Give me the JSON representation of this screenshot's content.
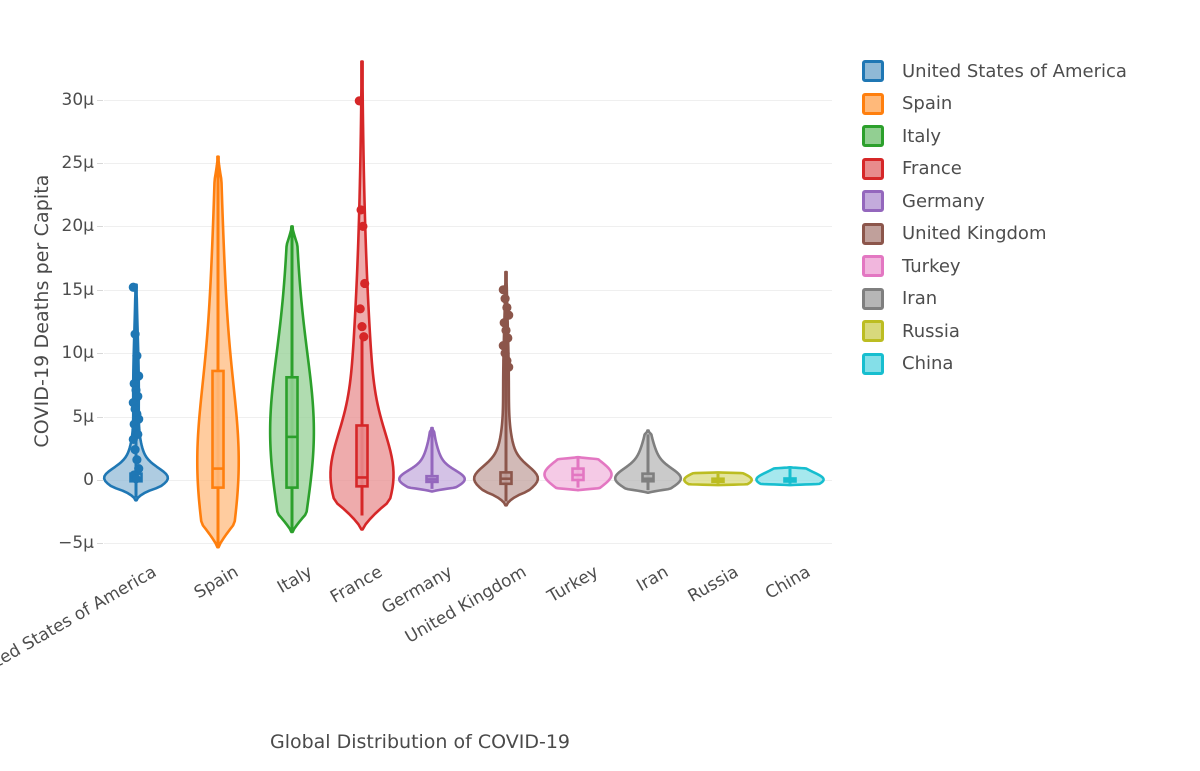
{
  "chart_data": {
    "type": "violin",
    "title": "",
    "xlabel": "Global Distribution of COVID-19",
    "ylabel": "COVID-19 Deaths per Capita",
    "ylim": [
      -7.5,
      34
    ],
    "ytick_labels": [
      "30μ",
      "25μ",
      "20μ",
      "15μ",
      "10μ",
      "5μ",
      "0",
      "−5μ"
    ],
    "ytick_values": [
      30,
      25,
      20,
      15,
      10,
      5,
      0,
      -5
    ],
    "grid": true,
    "legend_position": "right",
    "categories": [
      "United States of America",
      "Spain",
      "Italy",
      "France",
      "Germany",
      "United Kingdom",
      "Turkey",
      "Iran",
      "Russia",
      "China"
    ],
    "series": [
      {
        "name": "United States of America",
        "color": "#1f77b4",
        "fill": "#8fb9d6",
        "min": -1.4,
        "q1": -0.1,
        "median": 0.15,
        "q3": 0.5,
        "max": 15.2,
        "violin_top": 15.4,
        "violin_bottom": -1.6,
        "points": [
          15.2,
          11.5,
          9.8,
          8.2,
          7.6,
          7.1,
          6.6,
          6.1,
          5.6,
          5.2,
          4.8,
          4.4,
          4.0,
          3.6,
          3.2,
          2.4,
          1.6,
          0.9,
          0.4,
          0.1
        ]
      },
      {
        "name": "Spain",
        "color": "#ff7f0e",
        "fill": "#ffb97a",
        "min": -5.3,
        "q1": -0.6,
        "median": 0.9,
        "q3": 8.6,
        "max": 25.5,
        "violin_top": 25.5,
        "violin_bottom": -5.3,
        "points": []
      },
      {
        "name": "Italy",
        "color": "#2ca02c",
        "fill": "#92cf92",
        "min": -4.1,
        "q1": -0.6,
        "median": 3.4,
        "q3": 8.1,
        "max": 20.0,
        "violin_top": 20.0,
        "violin_bottom": -4.1,
        "points": []
      },
      {
        "name": "France",
        "color": "#d62728",
        "fill": "#e88b8c",
        "min": -2.8,
        "q1": -0.5,
        "median": 0.2,
        "q3": 4.3,
        "max": 11.2,
        "violin_top": 33.0,
        "violin_bottom": -3.9,
        "points": [
          29.9,
          21.3,
          20.0,
          15.5,
          13.5,
          12.1,
          11.3
        ]
      },
      {
        "name": "Germany",
        "color": "#9467bd",
        "fill": "#c3abdc",
        "min": -0.7,
        "q1": -0.15,
        "median": 0.05,
        "q3": 0.3,
        "max": 3.9,
        "violin_top": 4.1,
        "violin_bottom": -0.9,
        "points": []
      },
      {
        "name": "United Kingdom",
        "color": "#8c564b",
        "fill": "#c0a09b",
        "min": -1.7,
        "q1": -0.3,
        "median": 0.1,
        "q3": 0.6,
        "max": 16.3,
        "violin_top": 16.4,
        "violin_bottom": -2.0,
        "points": [
          15.0,
          14.3,
          13.6,
          13.0,
          12.4,
          11.8,
          11.2,
          10.6,
          10.0,
          9.4,
          8.9
        ]
      },
      {
        "name": "Turkey",
        "color": "#e377c2",
        "fill": "#f1b6dd",
        "min": -0.6,
        "q1": 0.0,
        "median": 0.4,
        "q3": 0.9,
        "max": 1.7,
        "violin_top": 1.8,
        "violin_bottom": -0.8,
        "points": []
      },
      {
        "name": "Iran",
        "color": "#7f7f7f",
        "fill": "#b6b6b6",
        "min": -0.8,
        "q1": -0.1,
        "median": 0.1,
        "q3": 0.5,
        "max": 3.6,
        "violin_top": 3.9,
        "violin_bottom": -1.0,
        "points": []
      },
      {
        "name": "Russia",
        "color": "#bcbd22",
        "fill": "#d8d97c",
        "min": -0.3,
        "q1": -0.05,
        "median": 0.0,
        "q3": 0.1,
        "max": 0.5,
        "violin_top": 0.6,
        "violin_bottom": -0.4,
        "points": []
      },
      {
        "name": "China",
        "color": "#17becf",
        "fill": "#84dfe8",
        "min": -0.3,
        "q1": -0.05,
        "median": 0.02,
        "q3": 0.12,
        "max": 0.9,
        "violin_top": 1.0,
        "violin_bottom": -0.4,
        "points": []
      }
    ]
  },
  "axes": {
    "ylabel": "COVID-19 Deaths per Capita",
    "xlabel": "Global Distribution of COVID-19",
    "yticks": [
      {
        "label": "30μ",
        "value": 30
      },
      {
        "label": "25μ",
        "value": 25
      },
      {
        "label": "20μ",
        "value": 20
      },
      {
        "label": "15μ",
        "value": 15
      },
      {
        "label": "10μ",
        "value": 10
      },
      {
        "label": "5μ",
        "value": 5
      },
      {
        "label": "0",
        "value": 0
      },
      {
        "label": "−5μ",
        "value": -5
      }
    ],
    "xticks": [
      "United States of America",
      "Spain",
      "Italy",
      "France",
      "Germany",
      "United Kingdom",
      "Turkey",
      "Iran",
      "Russia",
      "China"
    ]
  },
  "legend": {
    "items": [
      {
        "label": "United States of America",
        "color": "#1f77b4",
        "fill": "#8fb9d6"
      },
      {
        "label": "Spain",
        "color": "#ff7f0e",
        "fill": "#ffb97a"
      },
      {
        "label": "Italy",
        "color": "#2ca02c",
        "fill": "#92cf92"
      },
      {
        "label": "France",
        "color": "#d62728",
        "fill": "#e88b8c"
      },
      {
        "label": "Germany",
        "color": "#9467bd",
        "fill": "#c3abdc"
      },
      {
        "label": "United Kingdom",
        "color": "#8c564b",
        "fill": "#c0a09b"
      },
      {
        "label": "Turkey",
        "color": "#e377c2",
        "fill": "#f1b6dd"
      },
      {
        "label": "Iran",
        "color": "#7f7f7f",
        "fill": "#b6b6b6"
      },
      {
        "label": "Russia",
        "color": "#bcbd22",
        "fill": "#d8d97c"
      },
      {
        "label": "China",
        "color": "#17becf",
        "fill": "#84dfe8"
      }
    ]
  },
  "colors": {
    "background": "#ffffff",
    "gridline": "#efefef",
    "tick_text": "#4d4d4d",
    "axis_title": "#4a4a4a"
  }
}
